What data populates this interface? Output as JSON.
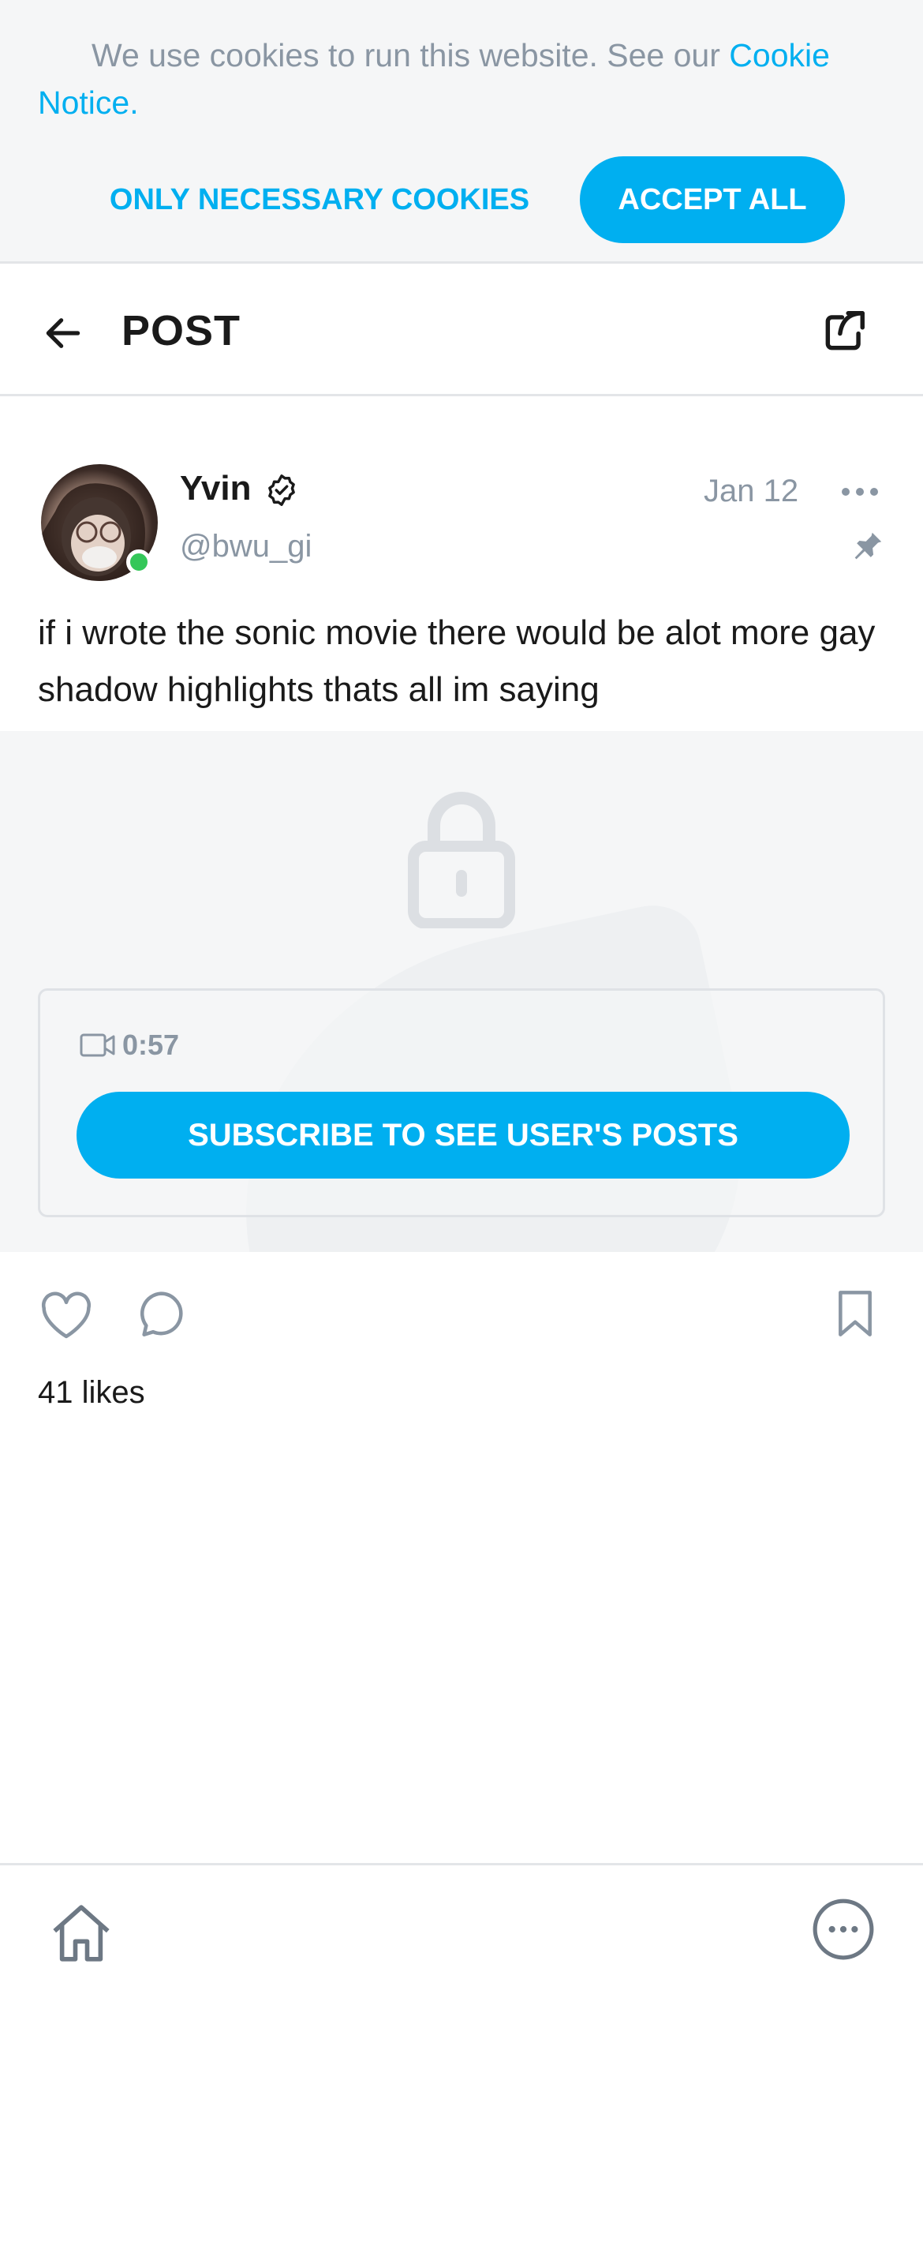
{
  "cookie_banner": {
    "text": "We use cookies to run this website. See our ",
    "link_text": "Cookie Notice",
    "text_end": ".",
    "necessary_button": "ONLY NECESSARY COOKIES",
    "accept_button": "ACCEPT ALL"
  },
  "header": {
    "title": "POST",
    "back_icon": "arrow-left-icon",
    "share_icon": "share-icon"
  },
  "post": {
    "author_name": "Yvin",
    "author_handle": "@bwu_gi",
    "verified_icon": "verified-badge-icon",
    "online": true,
    "date": "Jan 12",
    "more_icon": "more-dots-icon",
    "pin_icon": "pin-icon",
    "text": "if i wrote the sonic movie there would be alot more gay shadow highlights thats all im saying",
    "locked_media": {
      "lock_icon": "lock-icon",
      "video_icon": "video-camera-icon",
      "duration": "0:57",
      "subscribe_button": "SUBSCRIBE TO SEE USER'S POSTS"
    },
    "likes": "41 likes"
  },
  "bottom_nav": {
    "home_icon": "home-icon",
    "menu_icon": "more-circle-icon"
  },
  "colors": {
    "accent": "#00aff0",
    "muted_text": "#8a96a3",
    "online": "#34c759",
    "panel_bg": "#f5f6f7"
  }
}
